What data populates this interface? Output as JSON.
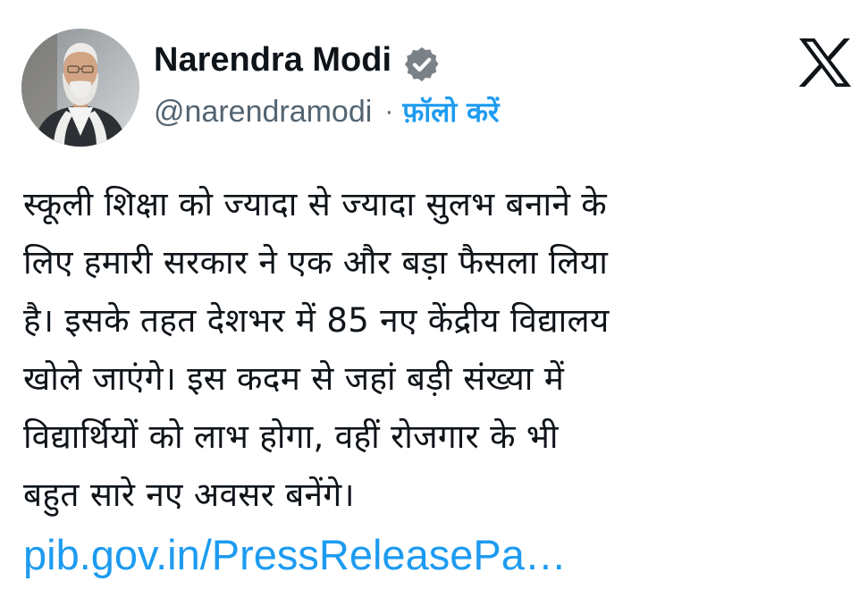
{
  "author": {
    "name": "Narendra Modi",
    "handle": "@narendramodi",
    "separator": "·",
    "follow_label": "फ़ॉलो करें",
    "avatar_icon": "profile-photo",
    "verified_icon": "verified-badge-icon"
  },
  "brand": {
    "logo_icon": "x-logo-icon"
  },
  "tweet": {
    "lines": [
      "स्कूली शिक्षा को ज्यादा से ज्यादा सुलभ बनाने के",
      "लिए हमारी सरकार ने एक और बड़ा फैसला लिया",
      "है। इसके तहत देशभर में 85 नए केंद्रीय विद्यालय",
      "खोले जाएंगे। इस कदम से जहां बड़ी संख्या में",
      "विद्यार्थियों को लाभ होगा, वहीं रोजगार के भी",
      "बहुत सारे नए अवसर बनेंगे।"
    ],
    "link_text": "pib.gov.in/PressReleasePa…"
  },
  "colors": {
    "text": "#0f1419",
    "secondary": "#536471",
    "accent": "#1d9bf0",
    "background": "#ffffff"
  }
}
